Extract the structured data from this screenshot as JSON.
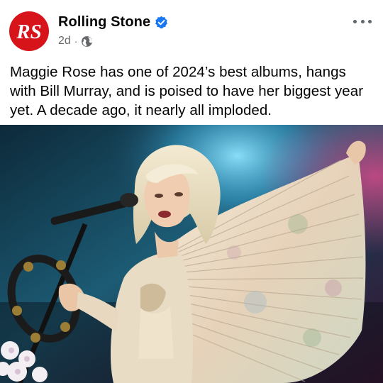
{
  "post": {
    "author": {
      "name": "Rolling Stone",
      "avatar_initials": "RS",
      "verified": true,
      "verified_icon": "verified-badge-icon"
    },
    "timestamp": "2d",
    "separator": "·",
    "audience_icon": "globe-icon",
    "more_icon": "more-options-icon",
    "text": "Maggie Rose has one of 2024’s best albums, hangs with Bill Murray, and is poised to have her biggest year yet. A decade ago, it nearly all imploded.",
    "photo": {
      "description_icon": "concert-photo"
    }
  },
  "colors": {
    "brand_red": "#d7141a",
    "verified_blue": "#1877f2",
    "meta_gray": "#65676b"
  }
}
